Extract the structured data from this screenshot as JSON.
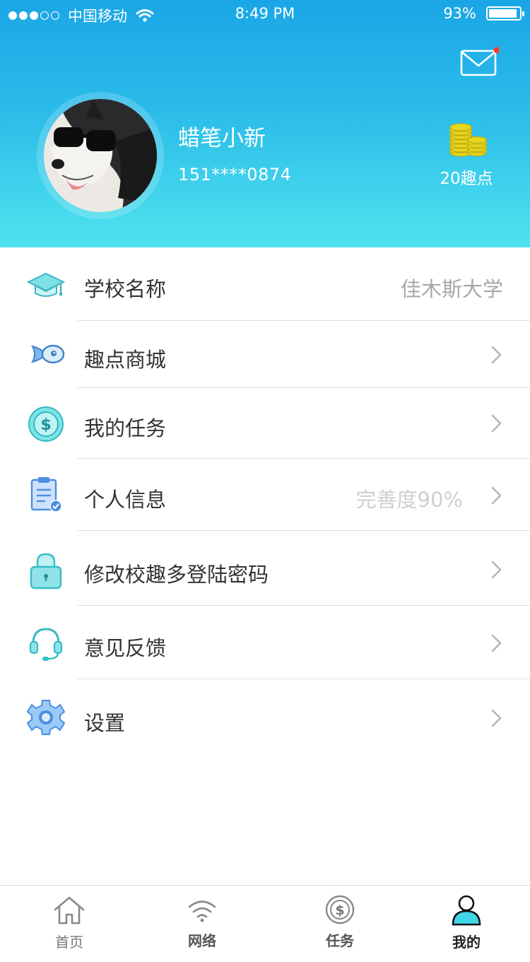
{
  "status_bar": {
    "carrier": "中国移动",
    "time": "8:49 PM",
    "battery": "93%",
    "battery_level": 0.93
  },
  "profile": {
    "name": "蜡笔小新",
    "phone": "151****0874",
    "points": "20趣点",
    "has_unread_mail": true
  },
  "menu": {
    "items": [
      {
        "label": "学校名称",
        "value": "佳木斯大学",
        "icon": "graduation-cap-icon"
      },
      {
        "label": "趣点商城",
        "value": "",
        "icon": "fish-icon"
      },
      {
        "label": "我的任务",
        "value": "",
        "icon": "dollar-coin-icon"
      },
      {
        "label": "个人信息",
        "value": "完善度90%",
        "icon": "clipboard-icon"
      },
      {
        "label": "修改校趣多登陆密码",
        "value": "",
        "icon": "lock-icon"
      },
      {
        "label": "意见反馈",
        "value": "",
        "icon": "headset-icon"
      },
      {
        "label": "设置",
        "value": "",
        "icon": "gear-icon"
      }
    ]
  },
  "tabbar": {
    "tabs": [
      {
        "label": "首页",
        "icon": "home-icon"
      },
      {
        "label": "网络",
        "icon": "wifi-icon"
      },
      {
        "label": "任务",
        "icon": "dollar-icon"
      },
      {
        "label": "我的",
        "icon": "user-icon",
        "active": true
      }
    ]
  },
  "colors": {
    "header_top": "#1aa6e6",
    "header_bottom": "#4fe3ee",
    "accent": "#3ecfe0",
    "mail_badge": "#ff3b30"
  }
}
